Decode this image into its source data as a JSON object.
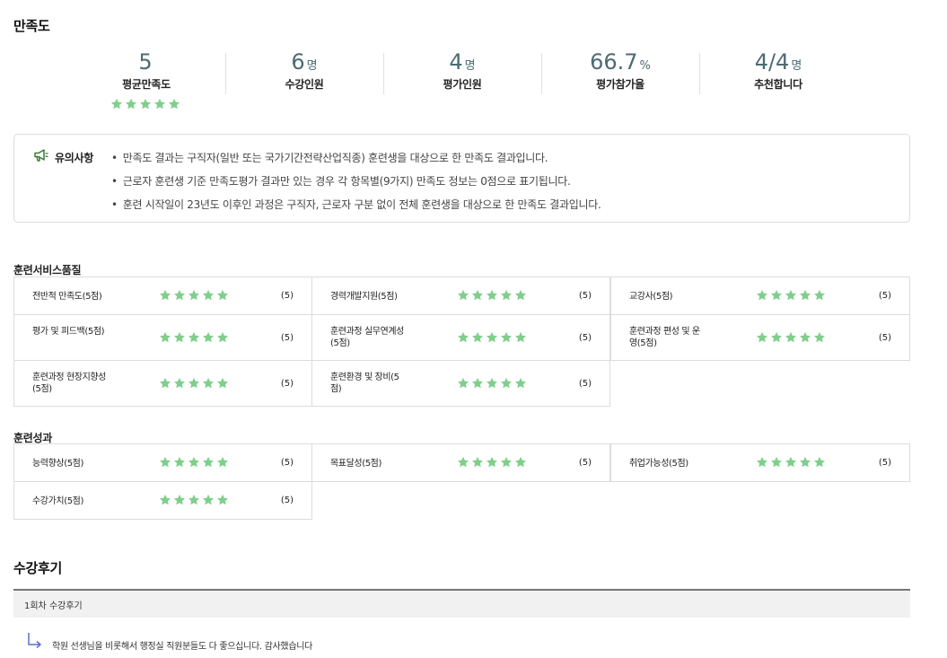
{
  "satisfaction": {
    "title": "만족도",
    "stats": [
      {
        "num": "5",
        "unit": "",
        "label": "평균만족도"
      },
      {
        "num": "6",
        "unit": "명",
        "label": "수강인원"
      },
      {
        "num": "4",
        "unit": "명",
        "label": "평가인원"
      },
      {
        "num": "66.7",
        "unit": "%",
        "label": "평가참가율"
      },
      {
        "num": "4/4",
        "unit": "명",
        "label": "추천합니다"
      }
    ],
    "average_rating": 5,
    "star_color": "#7fcf8b"
  },
  "notice": {
    "label": "유의사항",
    "icon": "megaphone-icon",
    "items": [
      "만족도 결과는 구직자(일반 또는 국가기간전략산업직종) 훈련생을 대상으로 한 만족도 결과입니다.",
      "근로자 훈련생 기준 만족도평가 결과만 있는 경우 각 항목별(9가지) 만족도 정보는 0점으로 표기됩니다.",
      "훈련 시작일이 23년도 이후인 과정은 구직자, 근로자 구분 없이 전체 훈련생을 대상으로 한 만족도 결과입니다."
    ]
  },
  "service_quality": {
    "label": "훈련서비스품질",
    "items": [
      {
        "name": "전반적 만족도(5점)",
        "rating": 5,
        "score": "(5)"
      },
      {
        "name": "경력개발지원(5점)",
        "rating": 5,
        "score": "(5)"
      },
      {
        "name": "교강사(5점)",
        "rating": 5,
        "score": "(5)"
      },
      {
        "name": "평가 및 피드백(5점)",
        "rating": 5,
        "score": "(5)"
      },
      {
        "name": "훈련과정 실무연계성(5점)",
        "rating": 5,
        "score": "(5)"
      },
      {
        "name": "훈련과정 편성 및 운영(5점)",
        "rating": 5,
        "score": "(5)"
      },
      {
        "name": "훈련과정 현장지향성(5점)",
        "rating": 5,
        "score": "(5)"
      },
      {
        "name": "훈련환경 및 장비(5점)",
        "rating": 5,
        "score": "(5)"
      }
    ]
  },
  "outcomes": {
    "label": "훈련성과",
    "items": [
      {
        "name": "능력향상(5점)",
        "rating": 5,
        "score": "(5)"
      },
      {
        "name": "목표달성(5점)",
        "rating": 5,
        "score": "(5)"
      },
      {
        "name": "취업가능성(5점)",
        "rating": 5,
        "score": "(5)"
      },
      {
        "name": "수강가치(5점)",
        "rating": 5,
        "score": "(5)"
      }
    ]
  },
  "reviews": {
    "title": "수강후기",
    "round_label": "1회차 수강후기",
    "items": [
      {
        "text": "학원 선생님을 비롯해서 행정실 직원분들도 다 좋으십니다. 감사했습니다",
        "icon": "reply-arrow-icon"
      }
    ]
  }
}
